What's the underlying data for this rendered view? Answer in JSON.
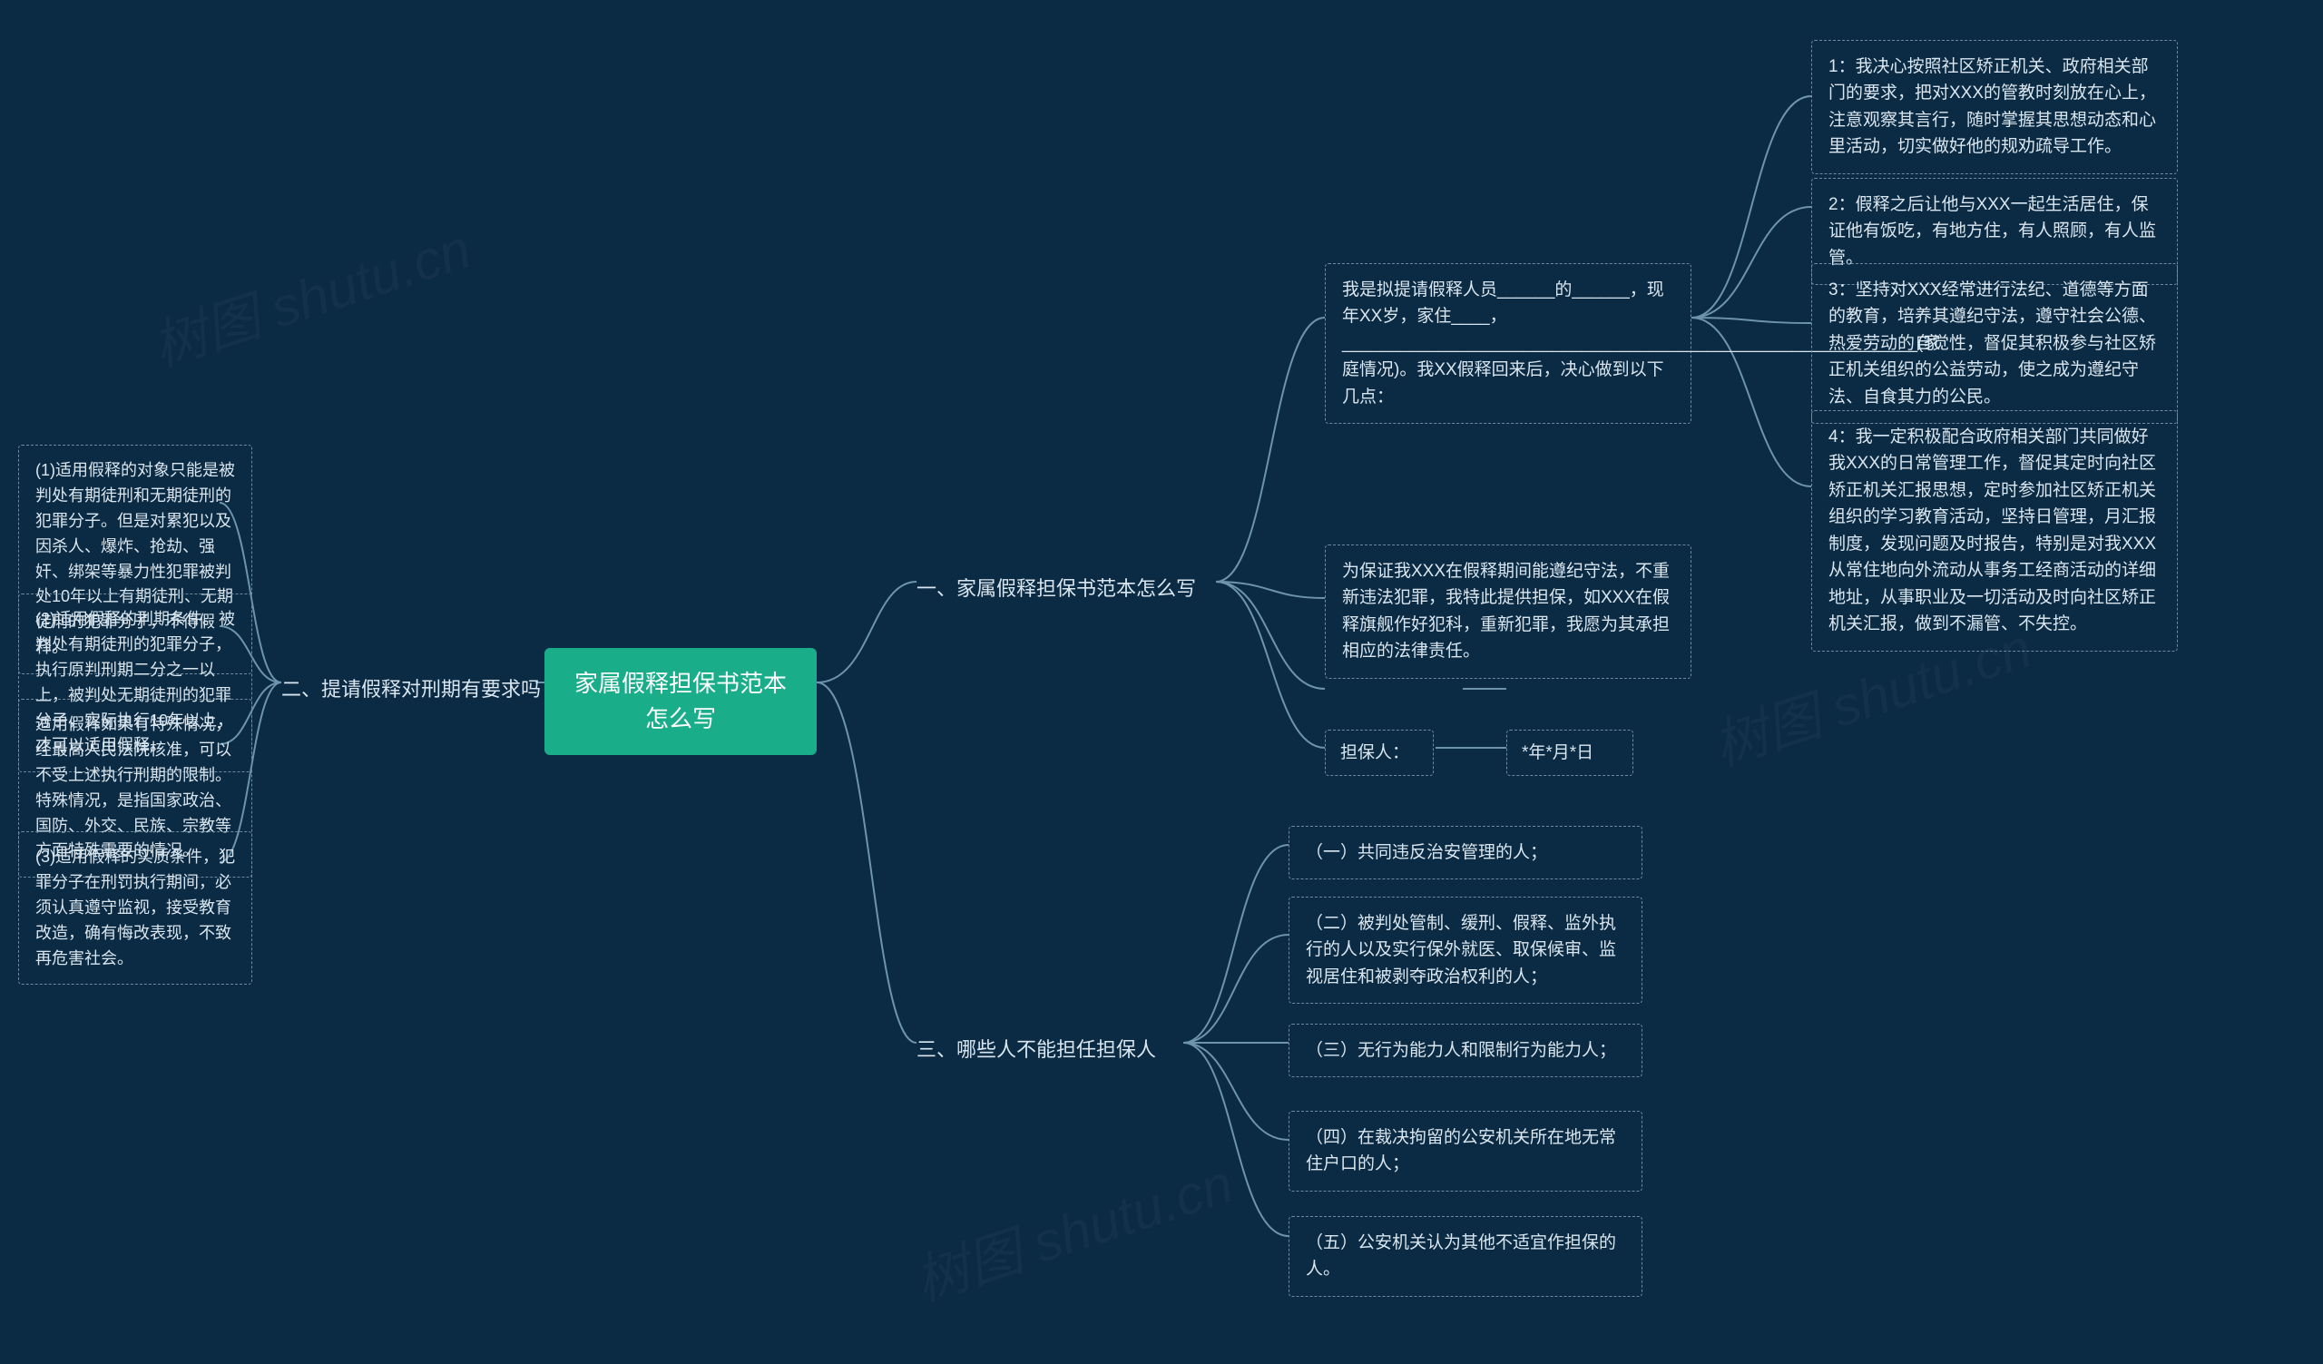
{
  "root": {
    "title": "家属假释担保书范本怎么写"
  },
  "branch1": {
    "label": "一、家属假释担保书范本怎么写",
    "intro": "我是拟提请假释人员______的______，现年XX岁，家住____，____________________________________________________________(家庭情况)。我XX假释回来后，决心做到以下几点：",
    "points": [
      "1：我决心按照社区矫正机关、政府相关部门的要求，把对XXX的管教时刻放在心上，注意观察其言行，随时掌握其思想动态和心里活动，切实做好他的规劝疏导工作。",
      "2：假释之后让他与XXX一起生活居住，保证他有饭吃，有地方住，有人照顾，有人监管。",
      "3：坚持对XXX经常进行法纪、道德等方面的教育，培养其遵纪守法，遵守社会公德、热爱劳动的自觉性，督促其积极参与社区矫正机关组织的公益劳动，使之成为遵纪守法、自食其力的公民。",
      "4：我一定积极配合政府相关部门共同做好我XXX的日常管理工作，督促其定时向社区矫正机关汇报思想，定时参加社区矫正机关组织的学习教育活动，坚持日管理，月汇报制度，发现问题及时报告，特别是对我XXX从常住地向外流动从事务工经商活动的详细地址，从事职业及一切活动及时向社区矫正机关汇报，做到不漏管、不失控。"
    ],
    "guarantee": "为保证我XXX在假释期间能遵纪守法，不重新违法犯罪，我特此提供担保，如XXX在假释旗舰作好犯科，重新犯罪，我愿为其承担相应的法律责任。",
    "guarantor_label": "担保人：",
    "date": "*年*月*日"
  },
  "branch2": {
    "label": "二、提请假释对刑期有要求吗",
    "items": [
      "(1)适用假释的对象只能是被判处有期徒刑和无期徒刑的犯罪分子。但是对累犯以及因杀人、爆炸、抢劫、强奸、绑架等暴力性犯罪被判处10年以上有期徒刑、无期徒刑的犯罪分子，不得假释。",
      "(2)适用假释的刑期条件。被判处有期徒刑的犯罪分子，执行原判刑期二分之一以上，被判处无期徒刑的犯罪分子，实际执行10年以上，才可以适用假释。",
      "适用假释如果有特殊情况，经最高人民法院核准，可以不受上述执行刑期的限制。特殊情况，是指国家政治、国防、外交、民族、宗教等方面特殊需要的情况。",
      "(3)适用假释的实质条件，犯罪分子在刑罚执行期间，必须认真遵守监视，接受教育改造，确有悔改表现，不致再危害社会。"
    ]
  },
  "branch3": {
    "label": "三、哪些人不能担任担保人",
    "items": [
      "（一）共同违反治安管理的人；",
      "（二）被判处管制、缓刑、假释、监外执行的人以及实行保外就医、取保候审、监视居住和被剥夺政治权利的人；",
      "（三）无行为能力人和限制行为能力人；",
      "（四）在裁决拘留的公安机关所在地无常住户口的人；",
      "（五）公安机关认为其他不适宜作担保的人。"
    ]
  },
  "watermark": "树图 shutu.cn"
}
